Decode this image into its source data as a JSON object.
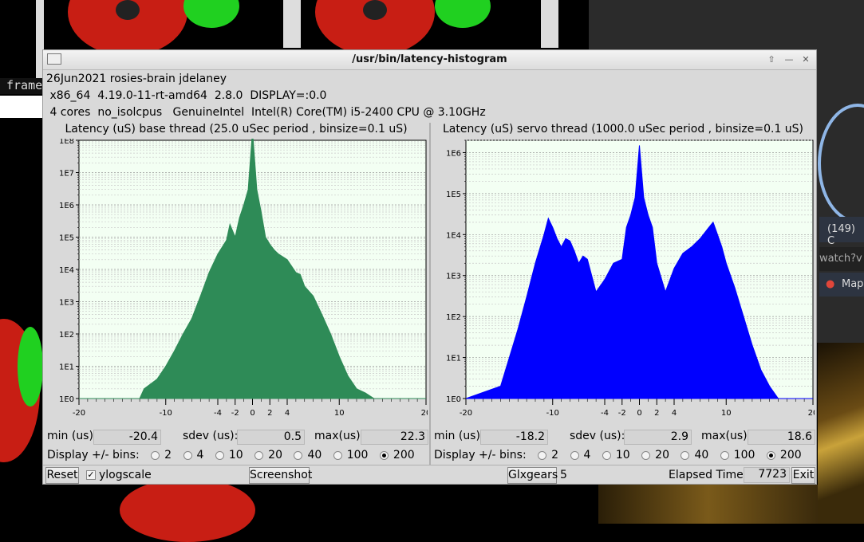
{
  "window": {
    "title": "/usr/bin/latency-histogram",
    "info_line1": "26Jun2021 rosies-brain jdelaney",
    "info_line2": " x86_64  4.19.0-11-rt-amd64  2.8.0  DISPLAY=:0.0",
    "info_line3": " 4 cores  no_isolcpus   GenuineIntel  Intel(R) Core(TM) i5-2400 CPU @ 3.10GHz"
  },
  "background": {
    "terminal_text": "frame",
    "tab1": "(149) C",
    "tab2": "watch?v",
    "tab3": "Map"
  },
  "colors": {
    "base": "#2e8b57",
    "servo": "#0000ff"
  },
  "panels": [
    {
      "title": "Latency (uS) base thread (25.0 uSec period , binsize=0.1 uS)",
      "min_label": "min (us)",
      "min": "-20.4",
      "sdev_label": "sdev (us):",
      "sdev": "0.5",
      "max_label": "max(us)",
      "max": "22.3",
      "bins_label": "Display +/- bins:"
    },
    {
      "title": "Latency (uS) servo thread (1000.0 uSec period , binsize=0.1 uS)",
      "min_label": "min (us)",
      "min": "-18.2",
      "sdev_label": "sdev (us):",
      "sdev": "2.9",
      "max_label": "max(us)",
      "max": "18.6",
      "bins_label": "Display +/- bins:"
    }
  ],
  "bin_options": [
    "2",
    "4",
    "10",
    "20",
    "40",
    "100",
    "200"
  ],
  "selected_bins": "200",
  "bottom": {
    "reset": "Reset",
    "ylogscale": "ylogscale",
    "ylogscale_checked": true,
    "screenshot": "Screenshot",
    "glxgears": "Glxgears",
    "glxgears_count": "5",
    "elapsed_label": "Elapsed Time:",
    "elapsed": "7723",
    "exit": "Exit"
  },
  "chart_data": [
    {
      "type": "area",
      "title": "Latency (uS) base thread (25.0 uSec period , binsize=0.1 uS)",
      "xlim": [
        -20,
        20
      ],
      "xticks": [
        "-20",
        "-10",
        "-4",
        "-2",
        "0",
        "2",
        "4",
        "10",
        "20"
      ],
      "yscale": "log",
      "ylim": [
        1,
        100000000
      ],
      "yticks": [
        "1E0",
        "1E1",
        "1E2",
        "1E3",
        "1E4",
        "1E5",
        "1E6",
        "1E7",
        "1E8"
      ],
      "series": [
        {
          "x": [
            -20,
            -13,
            -12.5,
            -11,
            -10,
            -9,
            -8,
            -7,
            -6,
            -5,
            -4,
            -3,
            -2.6,
            -2,
            -1.5,
            -1,
            -0.5,
            0,
            0.5,
            1,
            1.5,
            2,
            2.5,
            3,
            4,
            5,
            5.5,
            6,
            7,
            8,
            9,
            10,
            11,
            12,
            13,
            14,
            20
          ],
          "y": [
            1,
            1,
            2,
            4,
            10,
            30,
            100,
            300,
            1500,
            8000,
            30000,
            80000,
            250000,
            100000,
            400000,
            1000000,
            3000000,
            200000000,
            3000000,
            600000,
            100000,
            60000,
            40000,
            30000,
            20000,
            8000,
            7000,
            3000,
            1500,
            400,
            100,
            20,
            5,
            2,
            1.5,
            1,
            1
          ]
        }
      ],
      "grid": true
    },
    {
      "type": "area",
      "title": "Latency (uS) servo thread (1000.0 uSec period , binsize=0.1 uS)",
      "xlim": [
        -20,
        20
      ],
      "xticks": [
        "-20",
        "-10",
        "-4",
        "-2",
        "0",
        "2",
        "4",
        "10",
        "20"
      ],
      "yscale": "log",
      "ylim": [
        1,
        2000000
      ],
      "yticks": [
        "1E0",
        "1E1",
        "1E2",
        "1E3",
        "1E4",
        "1E5",
        "1E6"
      ],
      "series": [
        {
          "x": [
            -20,
            -16,
            -15,
            -14,
            -13,
            -12,
            -11,
            -10.5,
            -10,
            -9.5,
            -9,
            -8.5,
            -8,
            -7.5,
            -7,
            -6.5,
            -6,
            -5.5,
            -5,
            -4,
            -3,
            -2,
            -1.5,
            -1,
            -0.5,
            0,
            0.5,
            1,
            1.5,
            2,
            3,
            4,
            5,
            6,
            7,
            8,
            8.5,
            9,
            9.5,
            10,
            11,
            12,
            13,
            14,
            15,
            16,
            20
          ],
          "y": [
            1,
            2,
            10,
            50,
            300,
            2000,
            10000,
            25000,
            15000,
            8000,
            5000,
            8000,
            7000,
            4000,
            2000,
            3000,
            2500,
            1000,
            400,
            800,
            2000,
            2500,
            15000,
            30000,
            80000,
            1500000,
            80000,
            30000,
            15000,
            2000,
            400,
            1500,
            3500,
            5000,
            8000,
            15000,
            20000,
            10000,
            5000,
            2000,
            500,
            100,
            20,
            5,
            2,
            1,
            1
          ]
        }
      ],
      "grid": true
    }
  ]
}
